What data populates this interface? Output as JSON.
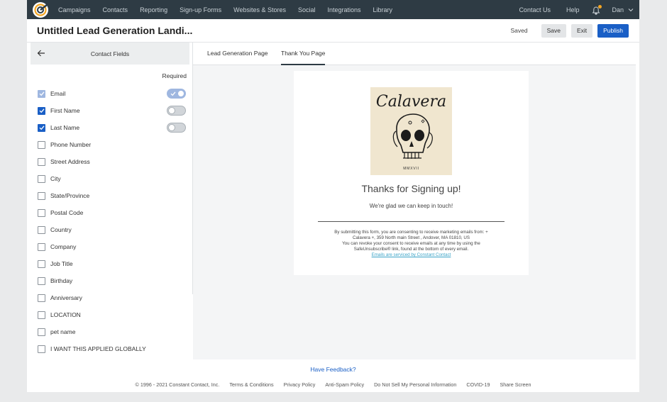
{
  "nav": {
    "items": [
      "Campaigns",
      "Contacts",
      "Reporting",
      "Sign-up Forms",
      "Websites & Stores",
      "Social",
      "Integrations",
      "Library"
    ],
    "contact_us": "Contact Us",
    "help": "Help",
    "user": "Dan",
    "accent": "#f5a623"
  },
  "header": {
    "title": "Untitled Lead Generation Landi...",
    "saved": "Saved",
    "save": "Save",
    "exit": "Exit",
    "publish": "Publish"
  },
  "sidebar": {
    "title": "Contact Fields",
    "required_label": "Required",
    "fields": [
      {
        "label": "Email",
        "checked": true,
        "disabled": true,
        "toggle": "on"
      },
      {
        "label": "First Name",
        "checked": true,
        "toggle": "off"
      },
      {
        "label": "Last Name",
        "checked": true,
        "toggle": "off"
      },
      {
        "label": "Phone Number",
        "checked": false
      },
      {
        "label": "Street Address",
        "checked": false
      },
      {
        "label": "City",
        "checked": false
      },
      {
        "label": "State/Province",
        "checked": false
      },
      {
        "label": "Postal Code",
        "checked": false
      },
      {
        "label": "Country",
        "checked": false
      },
      {
        "label": "Company",
        "checked": false
      },
      {
        "label": "Job Title",
        "checked": false
      },
      {
        "label": "Birthday",
        "checked": false
      },
      {
        "label": "Anniversary",
        "checked": false
      },
      {
        "label": "LOCATION",
        "checked": false
      },
      {
        "label": "pet name",
        "checked": false
      },
      {
        "label": "I WANT THIS APPLIED GLOBALLY",
        "checked": false
      }
    ]
  },
  "tabs": {
    "lead": "Lead Generation Page",
    "thanks": "Thank You Page"
  },
  "preview": {
    "brand_word": "Calavera",
    "brand_year": "MMXVII",
    "heading": "Thanks for Signing up!",
    "subheading": "We're glad we can keep in touch!",
    "consent_line1": "By submitting this form, you are consenting to receive marketing emails from: +",
    "consent_line2": "Calavera +, 359 North main Street , Andover, MA 01810, US",
    "consent_line3": "You can revoke your consent to receive emails at any time by using the",
    "consent_line4": "SafeUnsubscribe® link, found at the bottom of every email.",
    "consent_link": "Emails are serviced by Constant Contact"
  },
  "footer": {
    "feedback": "Have Feedback?",
    "links": [
      "© 1996 - 2021 Constant Contact, Inc.",
      "Terms & Conditions",
      "Privacy Policy",
      "Anti-Spam Policy",
      "Do Not Sell My Personal Information",
      "COVID-19",
      "Share Screen"
    ]
  }
}
